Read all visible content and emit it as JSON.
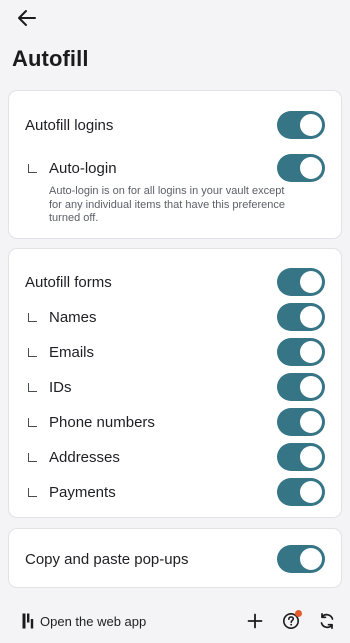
{
  "header": {
    "title": "Autofill"
  },
  "logins": {
    "autofill_logins": {
      "label": "Autofill logins",
      "enabled": true
    },
    "auto_login": {
      "label": "Auto-login",
      "enabled": true,
      "description": "Auto-login is on for all logins in your vault except for any individual items that have this preference turned off."
    }
  },
  "forms": {
    "label": "Autofill forms",
    "enabled": true,
    "items": [
      {
        "label": "Names",
        "enabled": true
      },
      {
        "label": "Emails",
        "enabled": true
      },
      {
        "label": "IDs",
        "enabled": true
      },
      {
        "label": "Phone numbers",
        "enabled": true
      },
      {
        "label": "Addresses",
        "enabled": true
      },
      {
        "label": "Payments",
        "enabled": true
      }
    ]
  },
  "popups": {
    "label": "Copy and paste pop-ups",
    "enabled": true
  },
  "footer": {
    "web_app_label": "Open the web app",
    "icons": [
      "web-app-logo-icon",
      "add-icon",
      "help-icon",
      "sync-icon"
    ],
    "notification_dot": true
  },
  "colors": {
    "toggle_on": "#367585",
    "notification": "#e35b2d",
    "background": "#f4f4f6"
  }
}
